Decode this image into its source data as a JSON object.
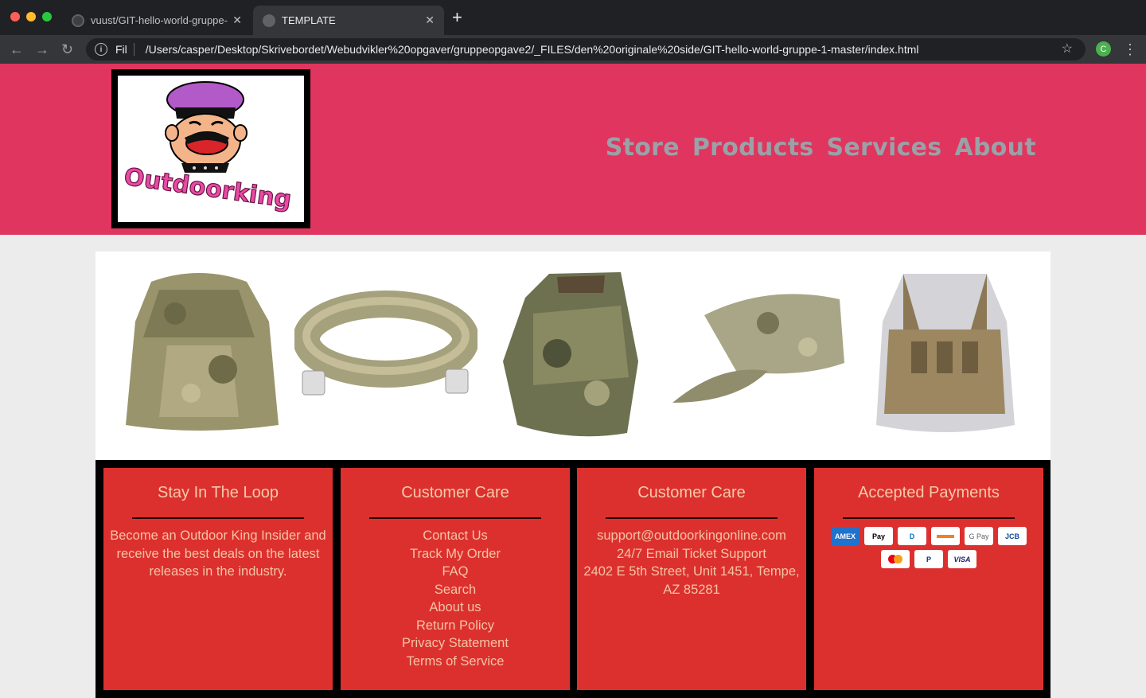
{
  "browser": {
    "tabs": [
      {
        "title": "vuust/GIT-hello-world-gruppe-",
        "active": false
      },
      {
        "title": "TEMPLATE",
        "active": true
      }
    ],
    "address_prefix": "Fil",
    "url": "/Users/casper/Desktop/Skrivebordet/Webudvikler%20opgaver/gruppeopgave2/_FILES/den%20originale%20side/GIT-hello-world-gruppe-1-master/index.html",
    "profile_initial": "C"
  },
  "header": {
    "logo_text": "Outdoorking",
    "nav": [
      "Store",
      "Products",
      "Services",
      "About"
    ],
    "bg_color": "#e0355e",
    "nav_color": "#9aa1a8"
  },
  "products": [
    {
      "name": "backpack-icon"
    },
    {
      "name": "belt-icon"
    },
    {
      "name": "glove-icon"
    },
    {
      "name": "cap-icon"
    },
    {
      "name": "vest-icon"
    }
  ],
  "footer": {
    "bg_color": "#dc302f",
    "loop": {
      "title": "Stay In The Loop",
      "text": "Become an Outdoor King Insider and receive the best deals on the latest releases in the industry."
    },
    "care": {
      "title": "Customer Care",
      "links": [
        "Contact Us",
        "Track My Order",
        "FAQ",
        "Search",
        "About us",
        "Return Policy",
        "Privacy Statement",
        "Terms of Service"
      ]
    },
    "contact": {
      "title": "Customer Care",
      "email": "support@outdoorkingonline.com",
      "support": "24/7 Email Ticket Support",
      "address": "2402 E 5th Street, Unit 1451, Tempe, AZ 85281"
    },
    "payments": {
      "title": "Accepted Payments",
      "methods": [
        "AMEX",
        "Pay",
        "D",
        "",
        "G Pay",
        "JCB",
        "",
        "P",
        "VISA"
      ]
    }
  }
}
